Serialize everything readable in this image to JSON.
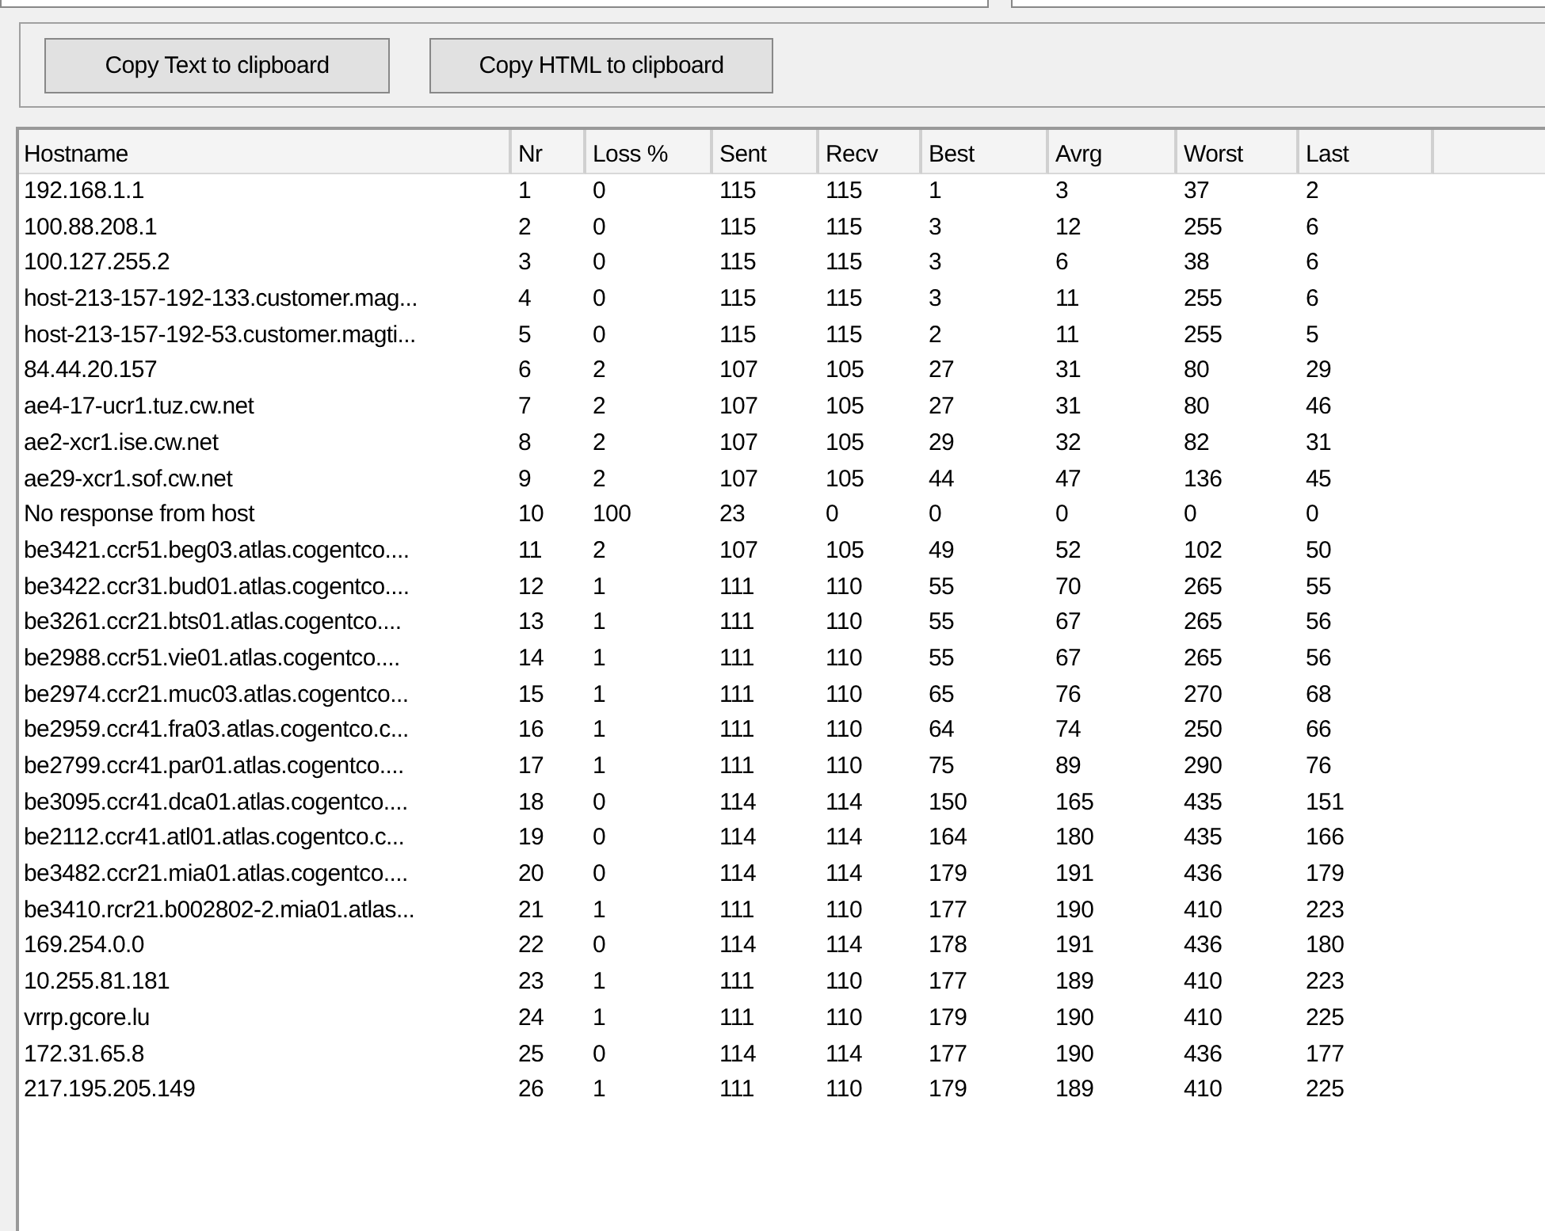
{
  "buttons": [
    "Copy Text to clipboard",
    "Copy HTML to clipboard"
  ],
  "table": {
    "columns": [
      "Hostname",
      "Nr",
      "Loss %",
      "Sent",
      "Recv",
      "Best",
      "Avrg",
      "Worst",
      "Last"
    ],
    "rows": [
      [
        "192.168.1.1",
        "1",
        "0",
        "115",
        "115",
        "1",
        "3",
        "37",
        "2"
      ],
      [
        "100.88.208.1",
        "2",
        "0",
        "115",
        "115",
        "3",
        "12",
        "255",
        "6"
      ],
      [
        "100.127.255.2",
        "3",
        "0",
        "115",
        "115",
        "3",
        "6",
        "38",
        "6"
      ],
      [
        "host-213-157-192-133.customer.mag...",
        "4",
        "0",
        "115",
        "115",
        "3",
        "11",
        "255",
        "6"
      ],
      [
        "host-213-157-192-53.customer.magti...",
        "5",
        "0",
        "115",
        "115",
        "2",
        "11",
        "255",
        "5"
      ],
      [
        "84.44.20.157",
        "6",
        "2",
        "107",
        "105",
        "27",
        "31",
        "80",
        "29"
      ],
      [
        "ae4-17-ucr1.tuz.cw.net",
        "7",
        "2",
        "107",
        "105",
        "27",
        "31",
        "80",
        "46"
      ],
      [
        "ae2-xcr1.ise.cw.net",
        "8",
        "2",
        "107",
        "105",
        "29",
        "32",
        "82",
        "31"
      ],
      [
        "ae29-xcr1.sof.cw.net",
        "9",
        "2",
        "107",
        "105",
        "44",
        "47",
        "136",
        "45"
      ],
      [
        "No response from host",
        "10",
        "100",
        "23",
        "0",
        "0",
        "0",
        "0",
        "0"
      ],
      [
        "be3421.ccr51.beg03.atlas.cogentco....",
        "11",
        "2",
        "107",
        "105",
        "49",
        "52",
        "102",
        "50"
      ],
      [
        "be3422.ccr31.bud01.atlas.cogentco....",
        "12",
        "1",
        "111",
        "110",
        "55",
        "70",
        "265",
        "55"
      ],
      [
        "be3261.ccr21.bts01.atlas.cogentco....",
        "13",
        "1",
        "111",
        "110",
        "55",
        "67",
        "265",
        "56"
      ],
      [
        "be2988.ccr51.vie01.atlas.cogentco....",
        "14",
        "1",
        "111",
        "110",
        "55",
        "67",
        "265",
        "56"
      ],
      [
        "be2974.ccr21.muc03.atlas.cogentco...",
        "15",
        "1",
        "111",
        "110",
        "65",
        "76",
        "270",
        "68"
      ],
      [
        "be2959.ccr41.fra03.atlas.cogentco.c...",
        "16",
        "1",
        "111",
        "110",
        "64",
        "74",
        "250",
        "66"
      ],
      [
        "be2799.ccr41.par01.atlas.cogentco....",
        "17",
        "1",
        "111",
        "110",
        "75",
        "89",
        "290",
        "76"
      ],
      [
        "be3095.ccr41.dca01.atlas.cogentco....",
        "18",
        "0",
        "114",
        "114",
        "150",
        "165",
        "435",
        "151"
      ],
      [
        "be2112.ccr41.atl01.atlas.cogentco.c...",
        "19",
        "0",
        "114",
        "114",
        "164",
        "180",
        "435",
        "166"
      ],
      [
        "be3482.ccr21.mia01.atlas.cogentco....",
        "20",
        "0",
        "114",
        "114",
        "179",
        "191",
        "436",
        "179"
      ],
      [
        "be3410.rcr21.b002802-2.mia01.atlas...",
        "21",
        "1",
        "111",
        "110",
        "177",
        "190",
        "410",
        "223"
      ],
      [
        "169.254.0.0",
        "22",
        "0",
        "114",
        "114",
        "178",
        "191",
        "436",
        "180"
      ],
      [
        "10.255.81.181",
        "23",
        "1",
        "111",
        "110",
        "177",
        "189",
        "410",
        "223"
      ],
      [
        "vrrp.gcore.lu",
        "24",
        "1",
        "111",
        "110",
        "179",
        "190",
        "410",
        "225"
      ],
      [
        "172.31.65.8",
        "25",
        "0",
        "114",
        "114",
        "177",
        "190",
        "436",
        "177"
      ],
      [
        "217.195.205.149",
        "26",
        "1",
        "111",
        "110",
        "179",
        "189",
        "410",
        "225"
      ]
    ]
  }
}
